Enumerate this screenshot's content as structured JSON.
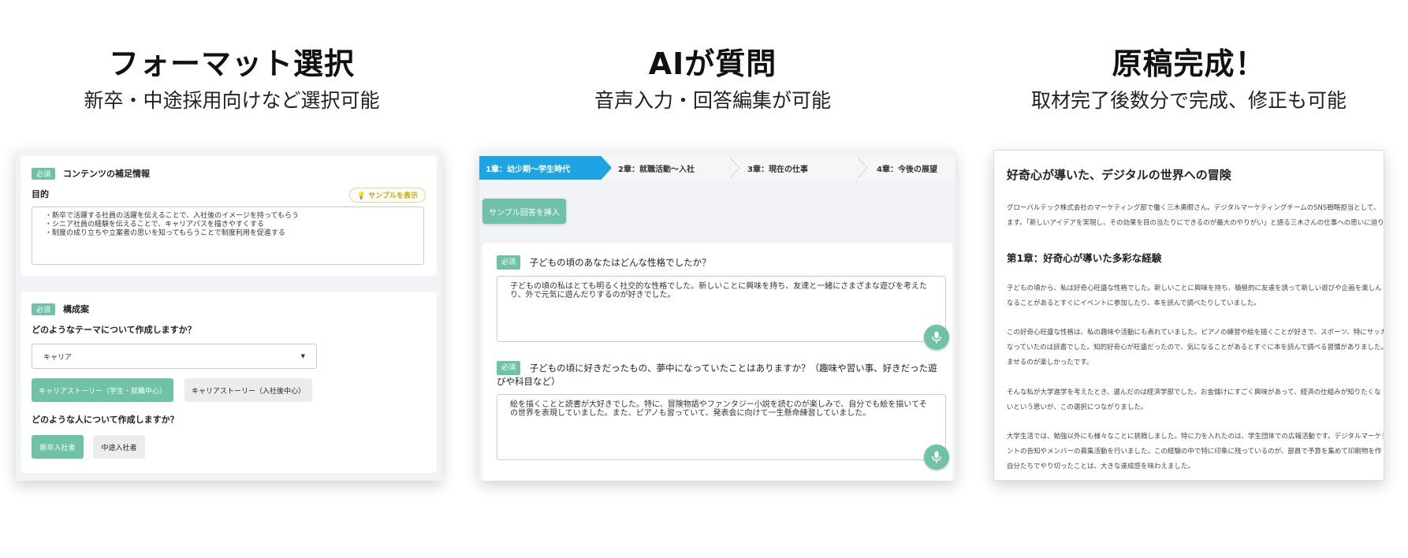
{
  "heroes": [
    {
      "title": "フォーマット選択",
      "subtitle": "新卒・中途採用向けなど選択可能"
    },
    {
      "title": "AIが質問",
      "subtitle": "音声入力・回答編集が可能"
    },
    {
      "title": "原稿完成！",
      "subtitle": "取材完了後数分で完成、修正も可能"
    }
  ],
  "panel1": {
    "required_badge": "必須",
    "section1_title": "コンテンツの補足情報",
    "purpose_label": "目的",
    "sample_button": "サンプルを表示",
    "purpose_lines": [
      "・新卒で活躍する社員の活躍を伝えることで、入社後のイメージを持ってもらう",
      "・シニア社員の経験を伝えることで、キャリアパスを描きやすくする",
      "・制度の成り立ちや立案者の思いを知ってもらうことで制度利用を促進する"
    ],
    "section2_title": "構成案",
    "theme_question": "どのようなテーマについて作成しますか？",
    "theme_select_value": "キャリア",
    "theme_options": [
      "キャリアストーリー（学生・就職中心）",
      "キャリアストーリー（入社後中心）"
    ],
    "person_question": "どのような人について作成しますか？",
    "person_options": [
      "新卒入社者",
      "中途入社者"
    ]
  },
  "panel2": {
    "steps": [
      "1章：幼少期〜学生時代",
      "2章：就職活動〜入社",
      "3章：現在の仕事",
      "4章：今後の展望"
    ],
    "insert_sample_button": "サンプル回答を挿入",
    "required_badge": "必須",
    "q1": "子どもの頃のあなたはどんな性格でしたか？",
    "a1": "子どもの頃の私はとても明るく社交的な性格でした。新しいことに興味を持ち、友達と一緒にさまざまな遊びを考えたり、外で元気に遊んだりするのが好きでした。",
    "q2": "子どもの頃に好きだったもの、夢中になっていたことはありますか？（趣味や習い事、好きだった遊びや科目など）",
    "a2": "絵を描くことと読書が大好きでした。特に、冒険物語やファンタジー小説を読むのが楽しみで、自分でも絵を描いてその世界を表現していました。また、ピアノも習っていて、発表会に向けて一生懸命練習していました。"
  },
  "panel3": {
    "title": "好奇心が導いた、デジタルの世界への冒険",
    "intro_lines": [
      "グローバルテック株式会社のマーケティング部で働く三木勇眼さん。デジタルマーケティングチームのSNS戦略担当として、",
      "ます。「新しいアイデアを実現し、その効果を目の当たりにできるのが最大のやりがい」と語る三木さんの仕事への思いに迫ります"
    ],
    "chapter1_title": "第1章：好奇心が導いた多彩な経験",
    "paragraphs": [
      [
        "子どもの頃から、私は好奇心旺盛な性格でした。新しいことに興味を持ち、積極的に友達を誘って新しい遊びや企画を楽しん",
        "なることがあるとすぐにイベントに参加したり、本を読んで調べたりしていました。"
      ],
      [
        "この好奇心旺盛な性格は、私の趣味や活動にも表れていました。ピアノの練習や絵を描くことが好きで、スポーツ、特にサッカー",
        "なっていたのは読書でした。知的好奇心が旺盛だったので、気になることがあるとすぐに本を読んで調べる習慣がありました。",
        "ませるのが楽しかったです。"
      ],
      [
        "そんな私が大学進学を考えたとき、選んだのは経済学部でした。お金儲けにすごく興味があって、経済の仕組みが知りたくな",
        "いという思いが、この選択につながりました。"
      ],
      [
        "大学生活では、勉強以外にも様々なことに挑戦しました。特に力を入れたのは、学生団体での広報活動です。デジタルマーケテ",
        "ントの告知やメンバーの募集活動を行いました。この経験の中で特に印象に残っているのが、部員で予算を集めて印刷物を作",
        "自分たちでやり切ったことは、大きな達成感を味わえました。"
      ]
    ]
  }
}
